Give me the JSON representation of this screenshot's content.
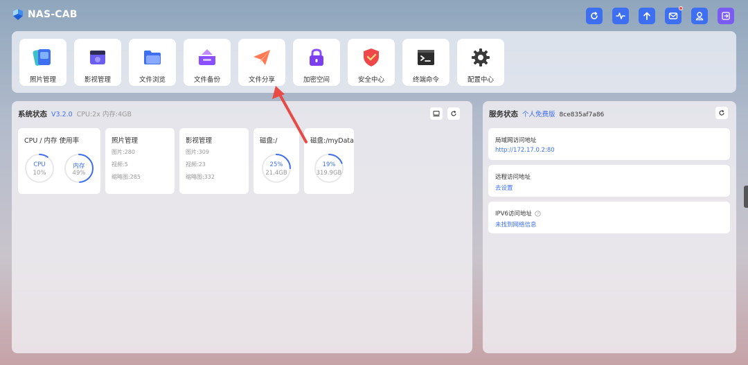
{
  "header": {
    "logo_text": "NAS-CAB",
    "buttons": [
      {
        "name": "refresh-icon",
        "color": "#3d6ff0"
      },
      {
        "name": "activity-icon",
        "color": "#3d6ff0"
      },
      {
        "name": "upload-icon",
        "color": "#3d6ff0"
      },
      {
        "name": "mail-icon",
        "color": "#3d6ff0",
        "badge": true
      },
      {
        "name": "user-icon",
        "color": "#3d6ff0"
      },
      {
        "name": "logout-icon",
        "color": "#7b5cf0"
      }
    ]
  },
  "apps": [
    {
      "label": "照片管理",
      "icon": "photos-icon"
    },
    {
      "label": "影视管理",
      "icon": "video-icon"
    },
    {
      "label": "文件浏览",
      "icon": "folder-icon"
    },
    {
      "label": "文件备份",
      "icon": "backup-icon"
    },
    {
      "label": "文件分享",
      "icon": "share-icon"
    },
    {
      "label": "加密空间",
      "icon": "lock-icon"
    },
    {
      "label": "安全中心",
      "icon": "shield-icon"
    },
    {
      "label": "终端命令",
      "icon": "terminal-icon"
    },
    {
      "label": "配置中心",
      "icon": "gear-icon"
    }
  ],
  "system_status": {
    "title": "系统状态",
    "version": "V3.2.0",
    "specs": "CPU:2x 内存:4GB",
    "usage_card": {
      "title": "CPU / 内存 使用率",
      "cpu_label": "CPU",
      "cpu_value": "10%",
      "cpu_percent": 10,
      "mem_label": "内存",
      "mem_value": "49%",
      "mem_percent": 49
    },
    "photo_card": {
      "title": "照片管理",
      "lines": [
        "图片:280",
        "视频:5",
        "缩略图:285"
      ]
    },
    "video_card": {
      "title": "影视管理",
      "lines": [
        "图片:309",
        "视频:23",
        "缩略图:332"
      ]
    },
    "disk_root": {
      "title": "磁盘:/",
      "value": "25%",
      "percent": 25,
      "size": "21.4GB"
    },
    "disk_data": {
      "title": "磁盘:/myData",
      "value": "19%",
      "percent": 19,
      "size": "319.9GB"
    }
  },
  "service_status": {
    "title": "服务状态",
    "edition": "个人免费版",
    "id": "8ce835af7a86",
    "items": [
      {
        "label": "局域网访问地址",
        "value": "http://172.17.0.2:80"
      },
      {
        "label": "远程访问地址",
        "value": "去设置"
      },
      {
        "label": "IPV6访问地址",
        "value": "未找到网络信息"
      }
    ]
  },
  "colors": {
    "accent": "#3d6ff0",
    "ring_track": "#e8e8e8",
    "arrow": "#e84a45"
  }
}
